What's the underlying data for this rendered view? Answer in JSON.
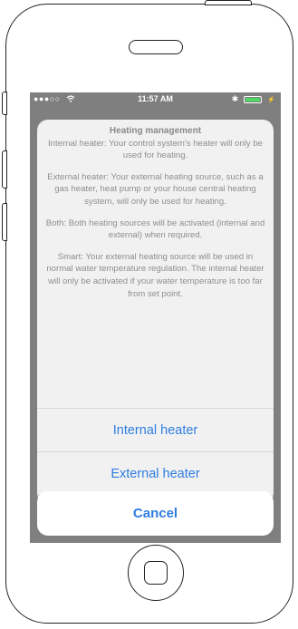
{
  "status_bar": {
    "carrier_signal": "●●●○○",
    "wifi_icon": "wifi-icon",
    "time": "11:57 AM",
    "bluetooth": "✱",
    "battery_icon": "battery-icon"
  },
  "action_sheet": {
    "title": "Heating management",
    "paragraphs": [
      "Internal heater: Your control system's heater will only be used for heating.",
      "External heater: Your external heating source, such as a gas heater, heat pump or your house central heating system, will only be used for heating.",
      "Both: Both heating sources will be activated (internal and external) when required.",
      "Smart: Your external heating source will be used in normal water temperature regulation.  The internal heater will only be activated if your water temperature is too far from set point."
    ],
    "options": [
      "Internal heater",
      "External heater"
    ],
    "cancel_label": "Cancel"
  },
  "colors": {
    "accent": "#2f7de1",
    "dim_overlay": "#7f7f7f",
    "battery": "#4cd964"
  }
}
